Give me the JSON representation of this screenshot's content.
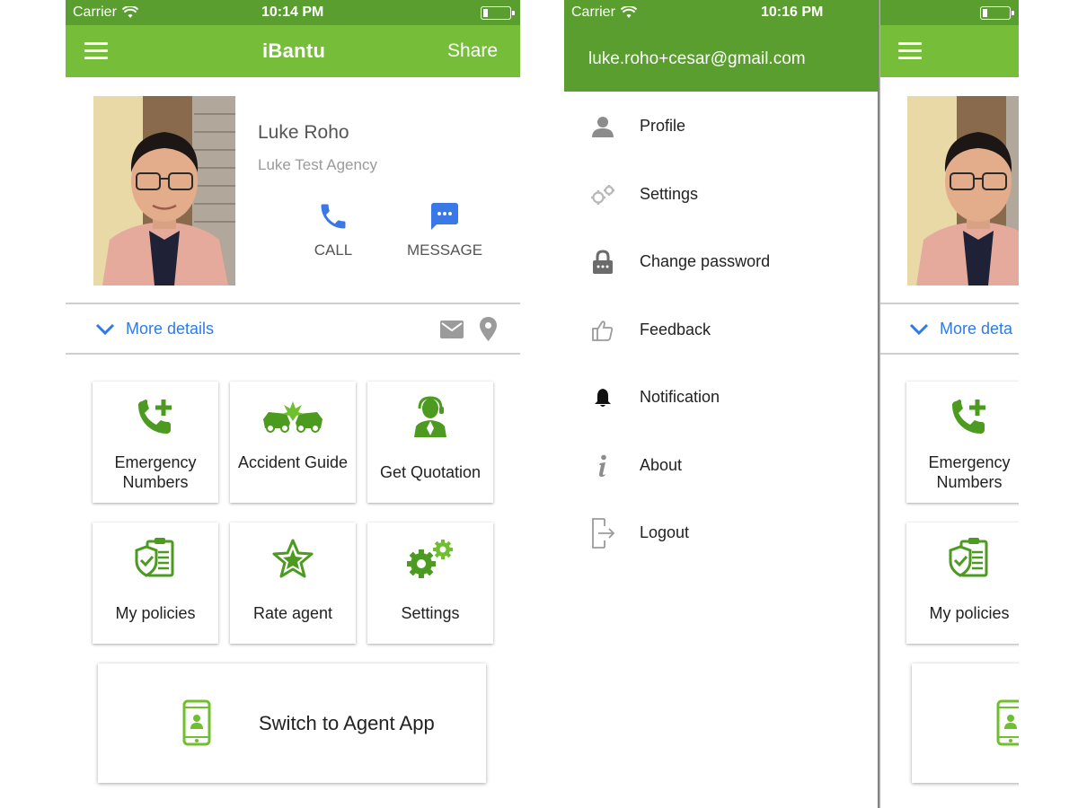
{
  "screen1": {
    "status": {
      "carrier": "Carrier",
      "time": "10:14 PM"
    },
    "nav": {
      "title": "iBantu",
      "share": "Share"
    },
    "agent": {
      "name": "Luke Roho",
      "agency": "Luke Test Agency"
    },
    "actions": {
      "call": "CALL",
      "message": "MESSAGE"
    },
    "more_details": "More details",
    "tiles": [
      {
        "label": "Emergency Numbers",
        "icon": "phone-plus-icon"
      },
      {
        "label": "Accident Guide",
        "icon": "car-crash-icon"
      },
      {
        "label": "Get Quotation",
        "icon": "agent-headset-icon"
      },
      {
        "label": "My policies",
        "icon": "policy-shield-icon"
      },
      {
        "label": "Rate agent",
        "icon": "star-icon"
      },
      {
        "label": "Settings",
        "icon": "gears-icon"
      }
    ],
    "switch_label": "Switch to Agent App"
  },
  "screen2": {
    "status": {
      "carrier": "Carrier",
      "time": "10:16 PM"
    },
    "drawer": {
      "email": "luke.roho+cesar@gmail.com",
      "items": [
        {
          "label": "Profile",
          "icon": "person-icon"
        },
        {
          "label": "Settings",
          "icon": "gears-icon"
        },
        {
          "label": "Change password",
          "icon": "lock-icon"
        },
        {
          "label": "Feedback",
          "icon": "thumbs-up-icon"
        },
        {
          "label": "Notification",
          "icon": "bell-icon"
        },
        {
          "label": "About",
          "icon": "info-icon"
        },
        {
          "label": "Logout",
          "icon": "logout-icon"
        }
      ]
    },
    "background": {
      "more_details": "More deta",
      "tiles": [
        {
          "label": "Emergency Numbers"
        },
        {
          "label": "My policies"
        }
      ]
    }
  },
  "colors": {
    "navbar": "#76bd3a",
    "status_bar": "#5a9e2f",
    "link_blue": "#2f7be6",
    "action_blue": "#3a78e8",
    "icon_green": "#4c9a1f"
  }
}
